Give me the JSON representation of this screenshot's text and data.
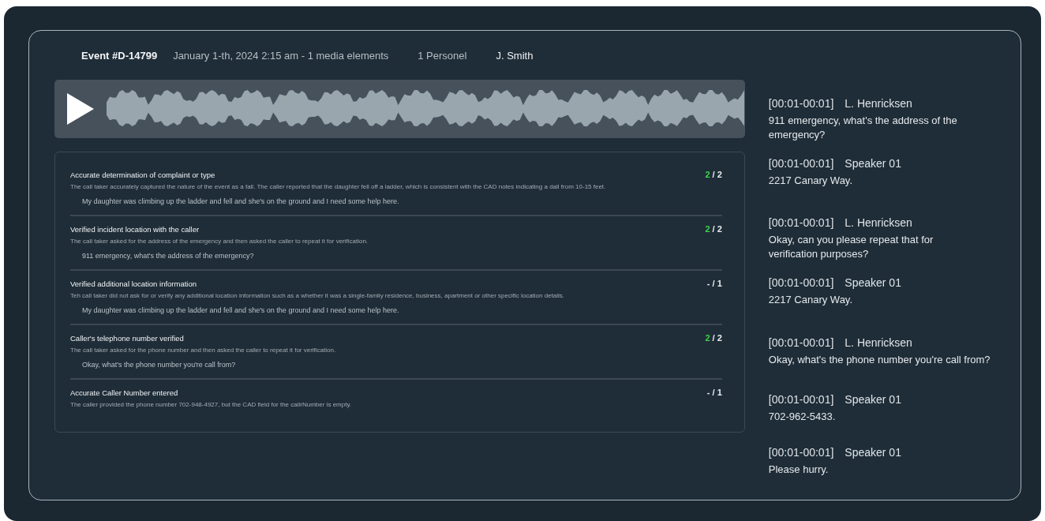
{
  "header": {
    "event": "Event #D-14799",
    "details": "January 1-th, 2024 2:15 am - 1 media elements",
    "personnel": "1 Personel",
    "name": "J. Smith"
  },
  "player": {
    "playing": false
  },
  "criteria": [
    {
      "title": "Accurate determination of complaint or type",
      "earned": "2",
      "total": "/ 2",
      "passed": true,
      "description": "The call taker accurately captured the nature of the event as a fall. The caller reported that the daughter fell off a ladder, which is consistent with the CAD notes indicating a dall from 10-15 feet.",
      "quote": "My daughter was climbing up the ladder and fell and she's on the ground and I need some help here."
    },
    {
      "title": "Verified incident location with the caller",
      "earned": "2",
      "total": "/ 2",
      "passed": true,
      "description": "The call taker asked for the address of the emergency and then asked the caller to repeat it for verification.",
      "quote": "911 emergency, what's the address of the emergency?"
    },
    {
      "title": "Verified additional location information",
      "earned": "-",
      "total": "/ 1",
      "passed": false,
      "description": "Teh call taker did not ask for or verify any additional location information such as a whether it was a single-family residence, business, apartment or other specific location details.",
      "quote": "My daughter was climbing up the ladder and fell and she's on the ground and I need some help here."
    },
    {
      "title": "Caller's telephone number verified",
      "earned": "2",
      "total": "/ 2",
      "passed": true,
      "description": "The call taker asked for the phone number and then asked the caller to repeat it for verification.",
      "quote": "Okay, what's the phone number you're call from?"
    },
    {
      "title": "Accurate Caller Number entered",
      "earned": "-",
      "total": "/ 1",
      "passed": false,
      "description": "The caller provided the phone number 702-948-4927, but the CAD field for the callrNumber is empty."
    }
  ],
  "transcript": [
    {
      "time": "[00:01-00:01]",
      "speaker": "L. Henricksen",
      "text": "911 emergency, what's the address of the emergency?"
    },
    {
      "time": "[00:01-00:01]",
      "speaker": "Speaker 01",
      "text": "2217 Canary Way."
    },
    {
      "time": "[00:01-00:01]",
      "speaker": "L. Henricksen",
      "text": "Okay, can you please repeat that for verification purposes?"
    },
    {
      "time": "[00:01-00:01]",
      "speaker": "Speaker 01",
      "text": "2217 Canary Way."
    },
    {
      "time": "[00:01-00:01]",
      "speaker": "L. Henricksen",
      "text": "Okay, what's the phone number you're call from?"
    },
    {
      "time": "[00:01-00:01]",
      "speaker": "Speaker 01",
      "text": "702-962-5433."
    },
    {
      "time": "[00:01-00:01]",
      "speaker": "Speaker 01",
      "text": "Please hurry."
    }
  ]
}
